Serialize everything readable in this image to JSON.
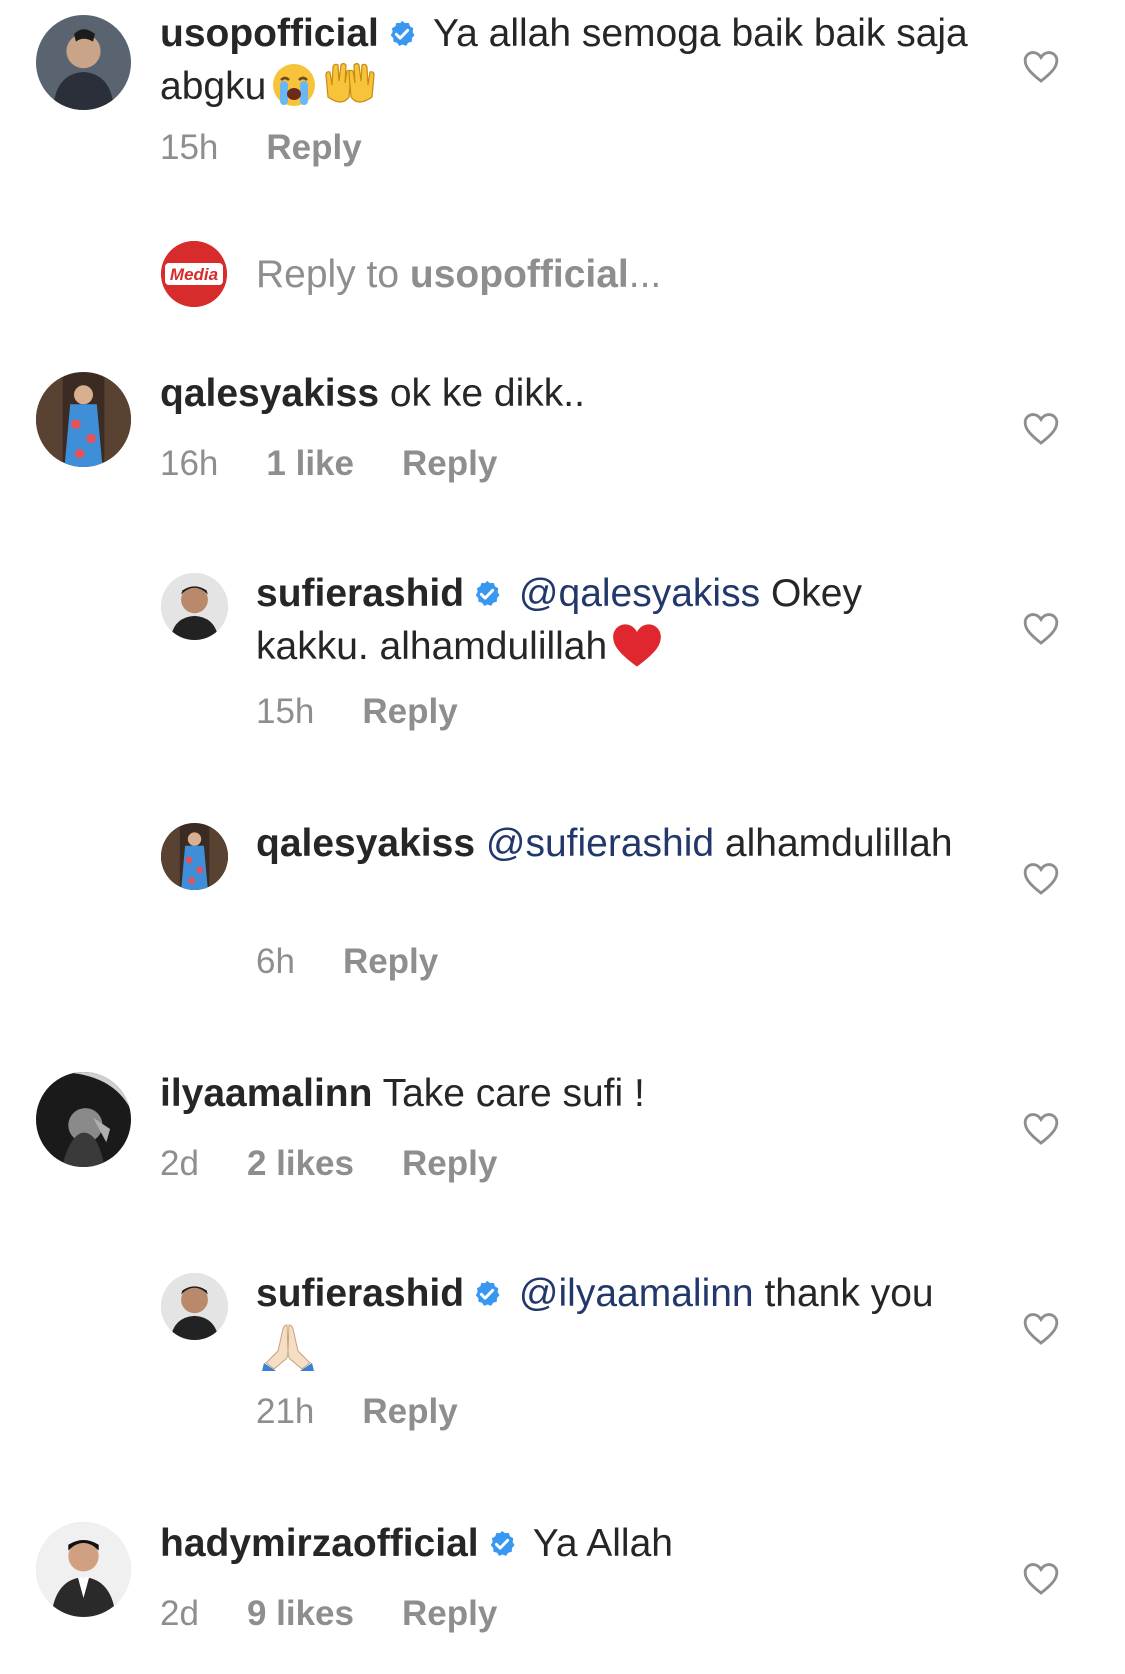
{
  "comments": [
    {
      "username": "usopofficial",
      "verified": true,
      "mention": "",
      "text": "Ya allah semoga baik baik saja abgku",
      "emojis": [
        "loudly-crying-face",
        "raising-hands"
      ],
      "time": "15h",
      "likes": "",
      "reply_label": "Reply"
    },
    {
      "username": "qalesyakiss",
      "verified": false,
      "mention": "",
      "text": "ok ke dikk..",
      "time": "16h",
      "likes": "1 like",
      "reply_label": "Reply"
    },
    {
      "username": "sufierashid",
      "verified": true,
      "mention": "@qalesyakiss",
      "text": "Okey kakku. alhamdulillah",
      "emojis": [
        "red-heart"
      ],
      "time": "15h",
      "likes": "",
      "reply_label": "Reply"
    },
    {
      "username": "qalesyakiss",
      "verified": false,
      "mention": "@sufierashid",
      "text": "alhamdulillah",
      "time": "6h",
      "likes": "",
      "reply_label": "Reply"
    },
    {
      "username": "ilyaamalinn",
      "verified": false,
      "mention": "",
      "text": "Take care sufi !",
      "time": "2d",
      "likes": "2 likes",
      "reply_label": "Reply"
    },
    {
      "username": "sufierashid",
      "verified": true,
      "mention": "@ilyaamalinn",
      "text": "thank you",
      "emojis": [
        "folded-hands"
      ],
      "time": "21h",
      "likes": "",
      "reply_label": "Reply"
    },
    {
      "username": "hadymirzaofficial",
      "verified": true,
      "mention": "",
      "text": "Ya Allah",
      "time": "2d",
      "likes": "9 likes",
      "reply_label": "Reply"
    }
  ],
  "reply_prompt": {
    "prefix": "Reply to ",
    "username": "usopofficial",
    "suffix": "...",
    "avatar_logo_text": "Media"
  },
  "colors": {
    "text": "#262626",
    "secondary": "#8e8e8e",
    "mention": "#22386b",
    "verified": "#3897f0",
    "logo_red": "#d82b2b"
  },
  "icons": {
    "like": "heart-outline-icon",
    "verified": "verified-badge-icon"
  }
}
